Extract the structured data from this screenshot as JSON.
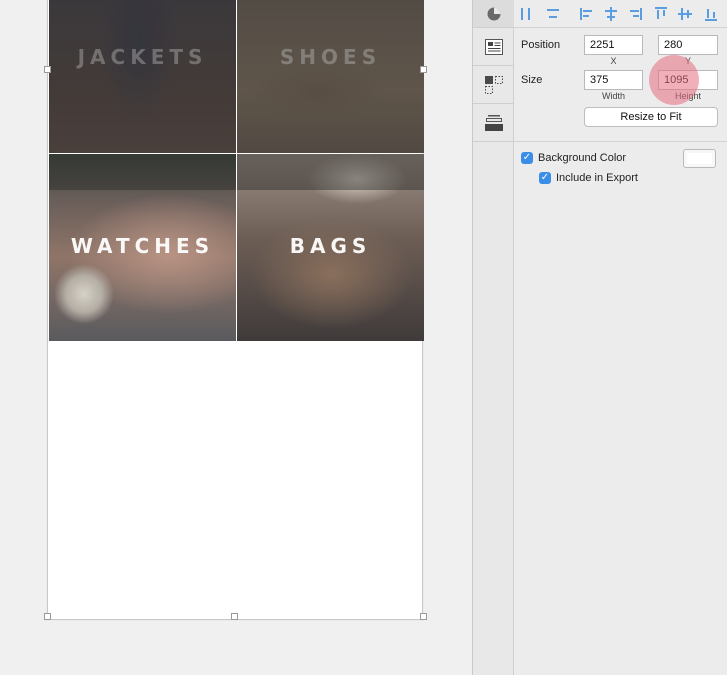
{
  "artboard": {
    "tiles": [
      {
        "label": "JACKETS"
      },
      {
        "label": "SHOES"
      },
      {
        "label": "WATCHES"
      },
      {
        "label": "BAGS"
      }
    ]
  },
  "toolstrip": {
    "tabs": [
      "arrange-icon",
      "layers-icon",
      "symbols-icon",
      "stack-icon"
    ]
  },
  "inspector": {
    "position": {
      "label": "Position",
      "x": "2251",
      "y": "280",
      "x_caption": "X",
      "y_caption": "Y"
    },
    "size": {
      "label": "Size",
      "width": "375",
      "height": "1095",
      "width_caption": "Width",
      "height_caption": "Height"
    },
    "resize_button": "Resize to Fit",
    "background_color": {
      "label": "Background Color",
      "checked": true,
      "swatch": "#ffffff"
    },
    "include_export": {
      "label": "Include in Export",
      "checked": true
    }
  },
  "colors": {
    "accent": "#3b8ee8",
    "align_icon": "#5a9de0",
    "click_marker": "#e66e82"
  }
}
